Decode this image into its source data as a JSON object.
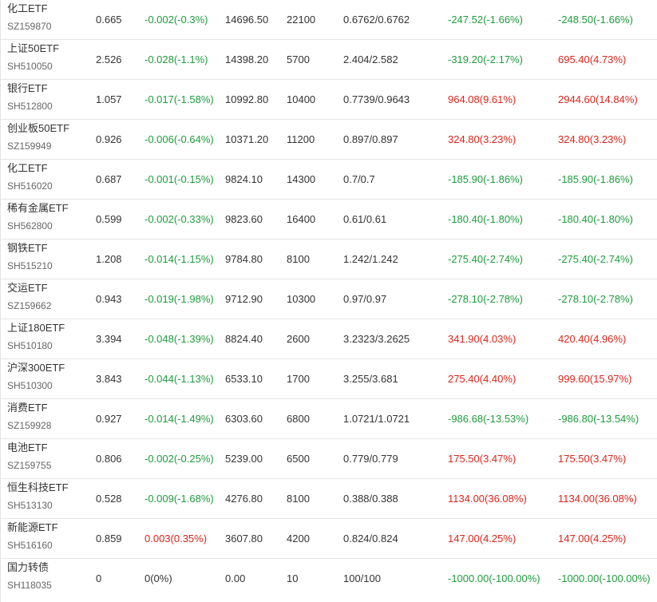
{
  "colors": {
    "up": "#d9261c",
    "down": "#1e9c3d",
    "flat": "#333333"
  },
  "rows": [
    {
      "name": "化工ETF",
      "code": "SZ159870",
      "price": "0.665",
      "change": "-0.002(-0.3%)",
      "change_dir": "down",
      "market_value": "14696.50",
      "quantity": "22100",
      "cost": "0.6762/0.6762",
      "day_pl": "-247.52(-1.66%)",
      "day_pl_dir": "down",
      "total_pl": "-248.50(-1.66%)",
      "total_pl_dir": "down"
    },
    {
      "name": "上证50ETF",
      "code": "SH510050",
      "price": "2.526",
      "change": "-0.028(-1.1%)",
      "change_dir": "down",
      "market_value": "14398.20",
      "quantity": "5700",
      "cost": "2.404/2.582",
      "day_pl": "-319.20(-2.17%)",
      "day_pl_dir": "down",
      "total_pl": "695.40(4.73%)",
      "total_pl_dir": "up"
    },
    {
      "name": "银行ETF",
      "code": "SH512800",
      "price": "1.057",
      "change": "-0.017(-1.58%)",
      "change_dir": "down",
      "market_value": "10992.80",
      "quantity": "10400",
      "cost": "0.7739/0.9643",
      "day_pl": "964.08(9.61%)",
      "day_pl_dir": "up",
      "total_pl": "2944.60(14.84%)",
      "total_pl_dir": "up"
    },
    {
      "name": "创业板50ETF",
      "code": "SZ159949",
      "price": "0.926",
      "change": "-0.006(-0.64%)",
      "change_dir": "down",
      "market_value": "10371.20",
      "quantity": "11200",
      "cost": "0.897/0.897",
      "day_pl": "324.80(3.23%)",
      "day_pl_dir": "up",
      "total_pl": "324.80(3.23%)",
      "total_pl_dir": "up"
    },
    {
      "name": "化工ETF",
      "code": "SH516020",
      "price": "0.687",
      "change": "-0.001(-0.15%)",
      "change_dir": "down",
      "market_value": "9824.10",
      "quantity": "14300",
      "cost": "0.7/0.7",
      "day_pl": "-185.90(-1.86%)",
      "day_pl_dir": "down",
      "total_pl": "-185.90(-1.86%)",
      "total_pl_dir": "down"
    },
    {
      "name": "稀有金属ETF",
      "code": "SH562800",
      "price": "0.599",
      "change": "-0.002(-0.33%)",
      "change_dir": "down",
      "market_value": "9823.60",
      "quantity": "16400",
      "cost": "0.61/0.61",
      "day_pl": "-180.40(-1.80%)",
      "day_pl_dir": "down",
      "total_pl": "-180.40(-1.80%)",
      "total_pl_dir": "down"
    },
    {
      "name": "钢铁ETF",
      "code": "SH515210",
      "price": "1.208",
      "change": "-0.014(-1.15%)",
      "change_dir": "down",
      "market_value": "9784.80",
      "quantity": "8100",
      "cost": "1.242/1.242",
      "day_pl": "-275.40(-2.74%)",
      "day_pl_dir": "down",
      "total_pl": "-275.40(-2.74%)",
      "total_pl_dir": "down"
    },
    {
      "name": "交运ETF",
      "code": "SZ159662",
      "price": "0.943",
      "change": "-0.019(-1.98%)",
      "change_dir": "down",
      "market_value": "9712.90",
      "quantity": "10300",
      "cost": "0.97/0.97",
      "day_pl": "-278.10(-2.78%)",
      "day_pl_dir": "down",
      "total_pl": "-278.10(-2.78%)",
      "total_pl_dir": "down"
    },
    {
      "name": "上证180ETF",
      "code": "SH510180",
      "price": "3.394",
      "change": "-0.048(-1.39%)",
      "change_dir": "down",
      "market_value": "8824.40",
      "quantity": "2600",
      "cost": "3.2323/3.2625",
      "day_pl": "341.90(4.03%)",
      "day_pl_dir": "up",
      "total_pl": "420.40(4.96%)",
      "total_pl_dir": "up"
    },
    {
      "name": "沪深300ETF",
      "code": "SH510300",
      "price": "3.843",
      "change": "-0.044(-1.13%)",
      "change_dir": "down",
      "market_value": "6533.10",
      "quantity": "1700",
      "cost": "3.255/3.681",
      "day_pl": "275.40(4.40%)",
      "day_pl_dir": "up",
      "total_pl": "999.60(15.97%)",
      "total_pl_dir": "up"
    },
    {
      "name": "消费ETF",
      "code": "SZ159928",
      "price": "0.927",
      "change": "-0.014(-1.49%)",
      "change_dir": "down",
      "market_value": "6303.60",
      "quantity": "6800",
      "cost": "1.0721/1.0721",
      "day_pl": "-986.68(-13.53%)",
      "day_pl_dir": "down",
      "total_pl": "-986.80(-13.54%)",
      "total_pl_dir": "down"
    },
    {
      "name": "电池ETF",
      "code": "SZ159755",
      "price": "0.806",
      "change": "-0.002(-0.25%)",
      "change_dir": "down",
      "market_value": "5239.00",
      "quantity": "6500",
      "cost": "0.779/0.779",
      "day_pl": "175.50(3.47%)",
      "day_pl_dir": "up",
      "total_pl": "175.50(3.47%)",
      "total_pl_dir": "up"
    },
    {
      "name": "恒生科技ETF",
      "code": "SH513130",
      "price": "0.528",
      "change": "-0.009(-1.68%)",
      "change_dir": "down",
      "market_value": "4276.80",
      "quantity": "8100",
      "cost": "0.388/0.388",
      "day_pl": "1134.00(36.08%)",
      "day_pl_dir": "up",
      "total_pl": "1134.00(36.08%)",
      "total_pl_dir": "up"
    },
    {
      "name": "新能源ETF",
      "code": "SH516160",
      "price": "0.859",
      "change": "0.003(0.35%)",
      "change_dir": "up",
      "market_value": "3607.80",
      "quantity": "4200",
      "cost": "0.824/0.824",
      "day_pl": "147.00(4.25%)",
      "day_pl_dir": "up",
      "total_pl": "147.00(4.25%)",
      "total_pl_dir": "up"
    },
    {
      "name": "国力转债",
      "code": "SH118035",
      "price": "0",
      "change": "0(0%)",
      "change_dir": "flat",
      "market_value": "0.00",
      "quantity": "10",
      "cost": "100/100",
      "day_pl": "-1000.00(-100.00%)",
      "day_pl_dir": "down",
      "total_pl": "-1000.00(-100.00%)",
      "total_pl_dir": "down"
    }
  ]
}
